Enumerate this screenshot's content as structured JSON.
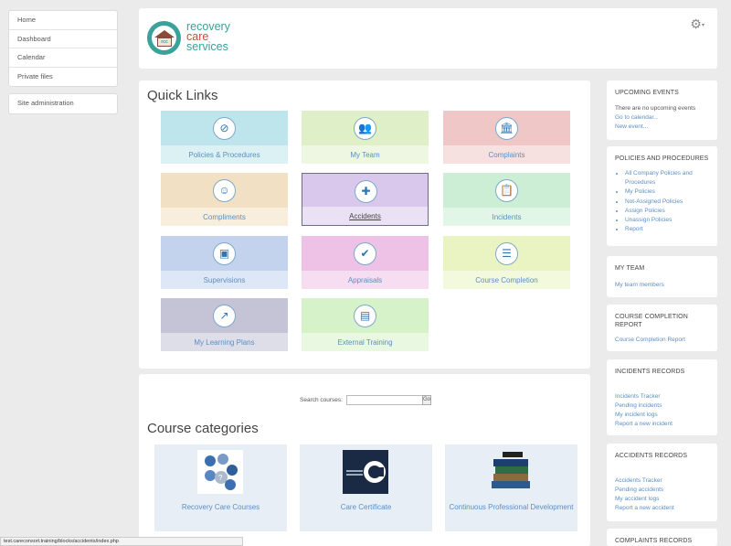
{
  "nav": {
    "main": [
      "Home",
      "Dashboard",
      "Calendar",
      "Private files"
    ],
    "admin": [
      "Site administration"
    ]
  },
  "header": {
    "logo_line1": "recovery",
    "logo_line2": "care",
    "logo_line3": "services",
    "logo_house_text": "rcc",
    "settings_icon": "gear-icon"
  },
  "quick_links": {
    "title": "Quick Links",
    "tiles": [
      {
        "label": "Policies & Procedures",
        "icon": "⊘",
        "color": "#bfe5ec"
      },
      {
        "label": "My Team",
        "icon": "👥",
        "color": "#dff0c9"
      },
      {
        "label": "Complaints",
        "icon": "🏛",
        "color": "#f0c7c7"
      },
      {
        "label": "Compliments",
        "icon": "☺",
        "color": "#f1e0c4"
      },
      {
        "label": "Accidents",
        "icon": "✚",
        "color": "#d9c8ec"
      },
      {
        "label": "Incidents",
        "icon": "📋",
        "color": "#cbeed5"
      },
      {
        "label": "Supervisions",
        "icon": "▣",
        "color": "#c3d3ee"
      },
      {
        "label": "Appraisals",
        "icon": "✔",
        "color": "#eec2e6"
      },
      {
        "label": "Course Completion",
        "icon": "☰",
        "color": "#eaf4c2"
      },
      {
        "label": "My Learning Plans",
        "icon": "↗",
        "color": "#c4c4d6"
      },
      {
        "label": "External Training",
        "icon": "▤",
        "color": "#d6f2c8"
      }
    ]
  },
  "courses": {
    "search_label": "Search courses:",
    "search_value": "",
    "go_label": "Go",
    "title": "Course categories",
    "categories": [
      "Recovery Care Courses",
      "Care Certificate",
      "Continuous Professional Development"
    ]
  },
  "sidebar": {
    "upcoming": {
      "title": "UPCOMING EVENTS",
      "empty": "There are no upcoming events",
      "links": [
        "Go to calendar...",
        "New event..."
      ]
    },
    "policies": {
      "title": "POLICIES AND PROCEDURES",
      "items": [
        "All Company Policies and Procedures",
        "My Policies",
        "Not-Assigned Policies",
        "Assign Policies",
        "Unassign Policies",
        "Report"
      ]
    },
    "team": {
      "title": "MY TEAM",
      "link": "My team members"
    },
    "course_report": {
      "title": "COURSE COMPLETION REPORT",
      "link": "Course Completion Report"
    },
    "incidents": {
      "title": "INCIDENTS RECORDS",
      "links": [
        "Incidents Tracker",
        "Pending incidents",
        "My incident logs",
        "Report a new incident"
      ]
    },
    "accidents": {
      "title": "ACCIDENTS RECORDS",
      "links": [
        "Accidents Tracker",
        "Pending accidents",
        "My accident logs",
        "Report a new accident"
      ]
    },
    "complaints": {
      "title": "COMPLAINTS RECORDS"
    }
  },
  "status_url": "test.careconsort.training/blocks/accidents/index.php"
}
